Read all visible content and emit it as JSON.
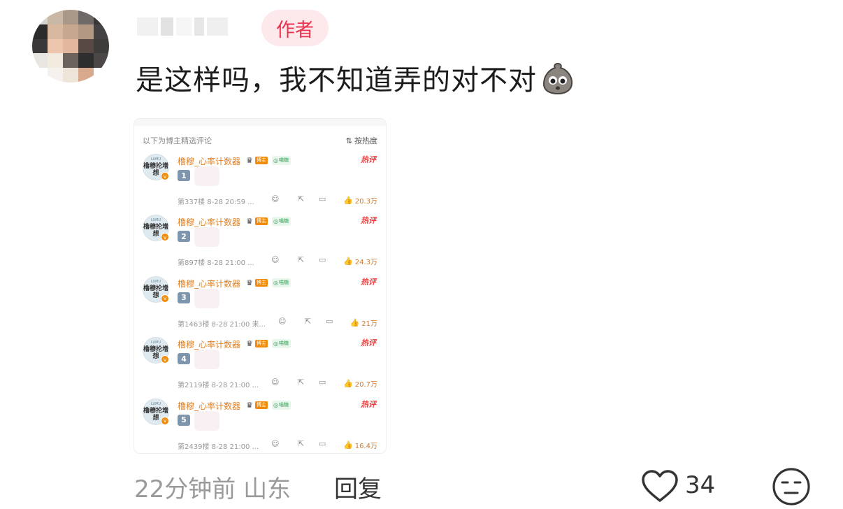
{
  "comment": {
    "author_badge": "作者",
    "text": "是这样吗，我不知道弄的对不对",
    "emoji": "pleading-potato-emoji",
    "time": "22分钟前",
    "location": "山东",
    "reply_label": "回复",
    "like_count": "34"
  },
  "screenshot": {
    "header_title": "以下为博主精选评论",
    "sort_label": "按热度",
    "items": [
      {
        "name": "橹穆_心率计数器",
        "blogger_tag": "博主",
        "tag": "喵糖",
        "hot": "热评",
        "num": "1",
        "floor_time": "第337楼 8-28 20:59 ...",
        "likes": "20.3万"
      },
      {
        "name": "橹穆_心率计数器",
        "blogger_tag": "博主",
        "tag": "喵糖",
        "hot": "热评",
        "num": "2",
        "floor_time": "第897楼 8-28 21:00 ...",
        "likes": "24.3万"
      },
      {
        "name": "橹穆_心率计数器",
        "blogger_tag": "博主",
        "tag": "喵糖",
        "hot": "热评",
        "num": "3",
        "floor_time": "第1463楼 8-28 21:00 来...",
        "likes": "21万"
      },
      {
        "name": "橹穆_心率计数器",
        "blogger_tag": "博主",
        "tag": "喵糖",
        "hot": "热评",
        "num": "4",
        "floor_time": "第2119楼 8-28 21:00 ...",
        "likes": "20.7万"
      },
      {
        "name": "橹穆_心率计数器",
        "blogger_tag": "博主",
        "tag": "喵糖",
        "hot": "热评",
        "num": "5",
        "floor_time": "第2439楼 8-28 21:00 ...",
        "likes": "16.4万"
      }
    ],
    "avatar_text_top": "LUMU",
    "avatar_text_main": "橹穆抡增想"
  },
  "colors": {
    "accent": "#e8344e",
    "author_badge_bg": "#fde8ec",
    "meta_gray": "#9a9a9a",
    "hot_red": "#ee3f3f",
    "name_orange": "#e07f22"
  }
}
